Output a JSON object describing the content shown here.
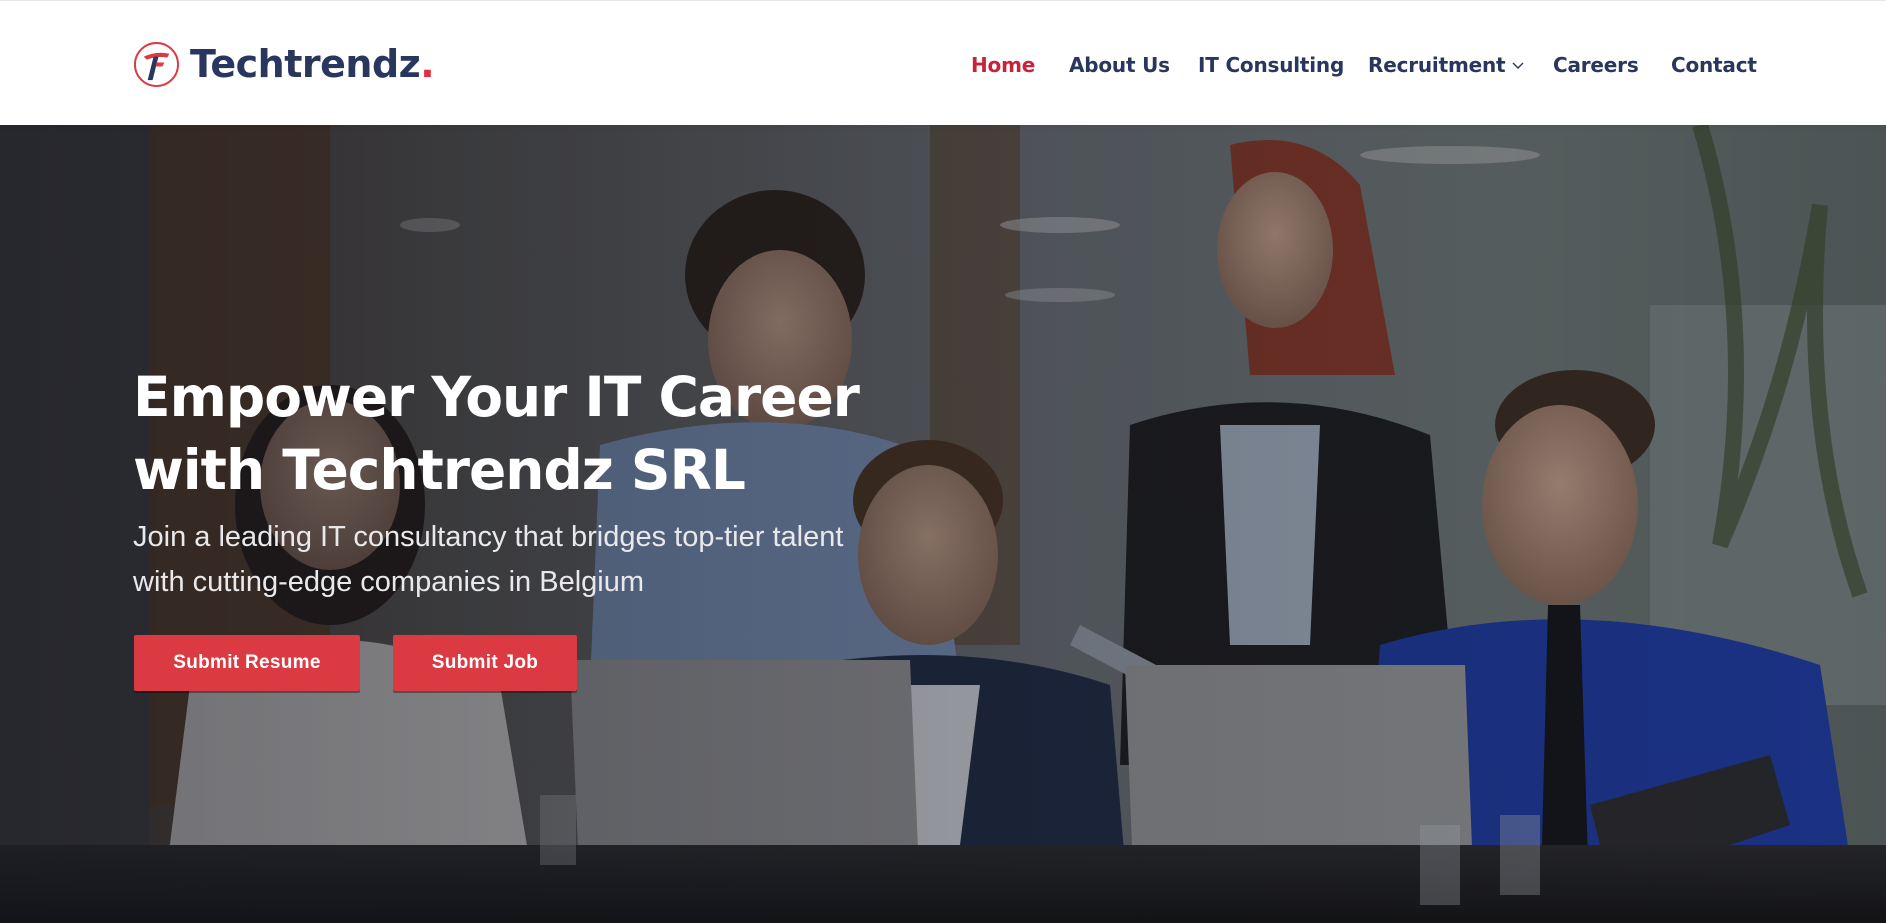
{
  "brand": {
    "name": "Techtrendz",
    "dot": "."
  },
  "nav": {
    "items": [
      {
        "label": "Home",
        "active": true
      },
      {
        "label": "About Us"
      },
      {
        "label": "IT Consulting"
      },
      {
        "label": "Recruitment",
        "dropdown": true,
        "icon": "chevron-down-icon"
      },
      {
        "label": "Careers"
      },
      {
        "label": "Contact"
      }
    ]
  },
  "hero": {
    "title_line1": "Empower Your IT Career",
    "title_line2": "with Techtrendz SRL",
    "subtitle_line1": "Join a leading IT consultancy that bridges top-tier talent",
    "subtitle_line2": "with cutting-edge companies in Belgium",
    "buttons": {
      "resume": "Submit Resume",
      "job": "Submit Job"
    }
  },
  "colors": {
    "brand_navy": "#29365e",
    "accent_red": "#dc3a42",
    "active_nav": "#c7243a"
  }
}
